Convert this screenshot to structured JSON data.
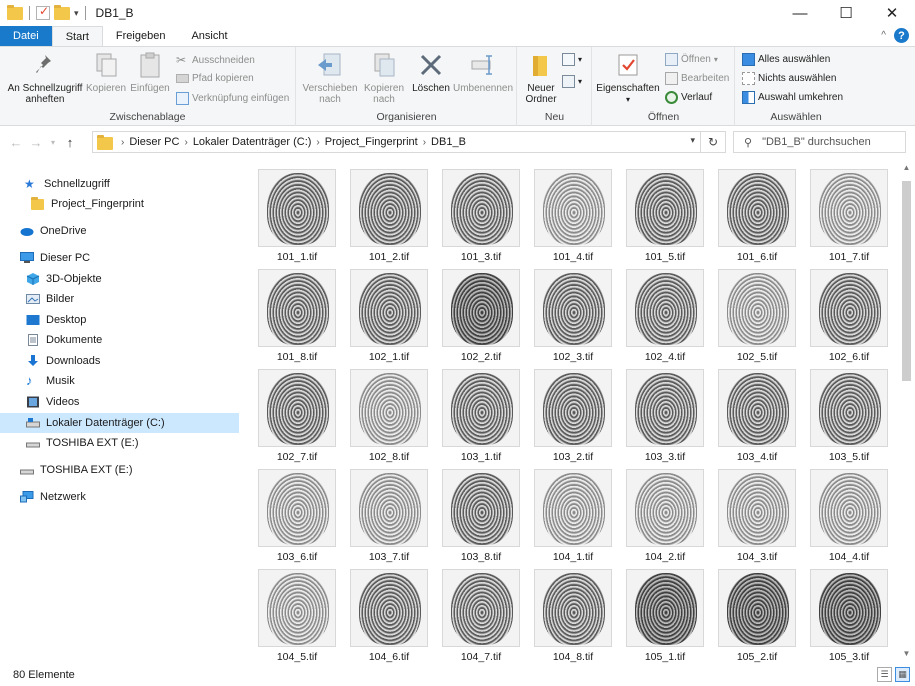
{
  "window": {
    "title": "DB1_B",
    "min": "—",
    "max": "☐",
    "close": "✕"
  },
  "tabs": [
    "Datei",
    "Start",
    "Freigeben",
    "Ansicht"
  ],
  "ribbon": {
    "clipboard": {
      "pin": "An Schnellzugriff anheften",
      "copy": "Kopieren",
      "paste": "Einfügen",
      "cut": "Ausschneiden",
      "copy_path": "Pfad kopieren",
      "paste_shortcut": "Verknüpfung einfügen",
      "label": "Zwischenablage"
    },
    "organize": {
      "move": "Verschieben nach",
      "copy_to": "Kopieren nach",
      "delete": "Löschen",
      "rename": "Umbenennen",
      "label": "Organisieren"
    },
    "new": {
      "new_folder": "Neuer Ordner",
      "label": "Neu"
    },
    "open": {
      "properties": "Eigenschaften",
      "open": "Öffnen",
      "edit": "Bearbeiten",
      "history": "Verlauf",
      "label": "Öffnen"
    },
    "select": {
      "select_all": "Alles auswählen",
      "select_none": "Nichts auswählen",
      "invert": "Auswahl umkehren",
      "label": "Auswählen"
    }
  },
  "address": {
    "crumbs": [
      "Dieser PC",
      "Lokaler Datenträger (C:)",
      "Project_Fingerprint",
      "DB1_B"
    ],
    "search_placeholder": "\"DB1_B\" durchsuchen"
  },
  "nav": [
    {
      "label": "Schnellzugriff",
      "icon": "star-icon"
    },
    {
      "label": "Project_Fingerprint",
      "icon": "folder-icon"
    },
    {
      "label": "OneDrive",
      "icon": "cloud-icon"
    },
    {
      "label": "Dieser PC",
      "icon": "computer-icon"
    },
    {
      "label": "3D-Objekte",
      "icon": "cube-icon"
    },
    {
      "label": "Bilder",
      "icon": "pictures-icon"
    },
    {
      "label": "Desktop",
      "icon": "desktop-icon"
    },
    {
      "label": "Dokumente",
      "icon": "document-icon"
    },
    {
      "label": "Downloads",
      "icon": "download-icon"
    },
    {
      "label": "Musik",
      "icon": "music-icon"
    },
    {
      "label": "Videos",
      "icon": "video-icon"
    },
    {
      "label": "Lokaler Datenträger (C:)",
      "icon": "drive-icon"
    },
    {
      "label": "TOSHIBA EXT (E:)",
      "icon": "usb-drive-icon"
    },
    {
      "label": "TOSHIBA EXT (E:)",
      "icon": "usb-drive-icon"
    },
    {
      "label": "Netzwerk",
      "icon": "network-icon"
    }
  ],
  "files": [
    "101_1.tif",
    "101_2.tif",
    "101_3.tif",
    "101_4.tif",
    "101_5.tif",
    "101_6.tif",
    "101_7.tif",
    "101_8.tif",
    "102_1.tif",
    "102_2.tif",
    "102_3.tif",
    "102_4.tif",
    "102_5.tif",
    "102_6.tif",
    "102_7.tif",
    "102_8.tif",
    "103_1.tif",
    "103_2.tif",
    "103_3.tif",
    "103_4.tif",
    "103_5.tif",
    "103_6.tif",
    "103_7.tif",
    "103_8.tif",
    "104_1.tif",
    "104_2.tif",
    "104_3.tif",
    "104_4.tif",
    "104_5.tif",
    "104_6.tif",
    "104_7.tif",
    "104_8.tif",
    "105_1.tif",
    "105_2.tif",
    "105_3.tif"
  ],
  "status": {
    "count": "80 Elemente"
  }
}
